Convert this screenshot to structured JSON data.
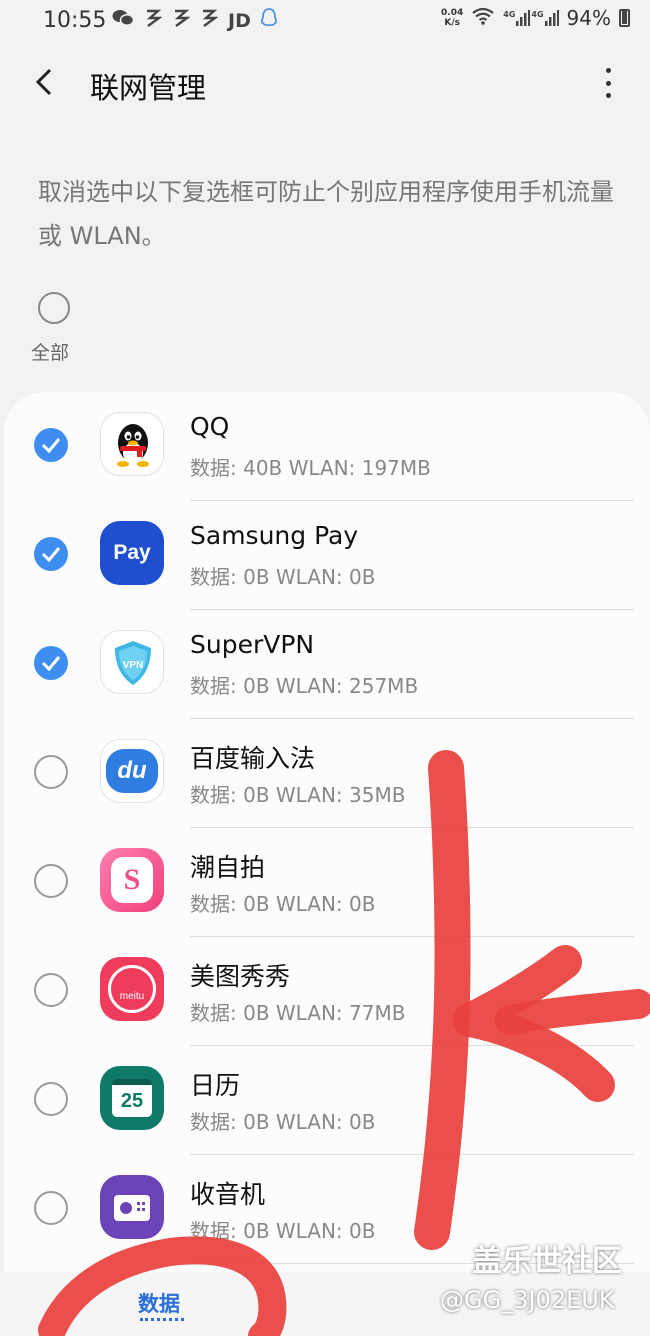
{
  "status_bar": {
    "time": "10:55",
    "left_icons": [
      "wechat-icon",
      "app-icon",
      "app-icon",
      "app-icon",
      "jd-icon",
      "qq-icon"
    ],
    "jd_label": "JD",
    "net_speed_value": "0.04",
    "net_speed_unit": "K/s",
    "signal_label_1": "4G",
    "signal_label_2": "4G",
    "battery": "94%"
  },
  "header": {
    "title": "联网管理",
    "back_icon": "back-arrow-icon",
    "more_icon": "more-vert-icon"
  },
  "description": "取消选中以下复选框可防止个别应用程序使用手机流量或 WLAN。",
  "all_toggle": {
    "label": "全部",
    "checked": false
  },
  "apps": [
    {
      "name": "QQ",
      "usage": "数据: 40B  WLAN: 197MB",
      "checked": true,
      "icon": "qq-penguin-icon"
    },
    {
      "name": "Samsung Pay",
      "usage": "数据: 0B  WLAN: 0B",
      "checked": true,
      "icon": "samsung-pay-icon",
      "icon_text": "Pay"
    },
    {
      "name": "SuperVPN",
      "usage": "数据: 0B  WLAN: 257MB",
      "checked": true,
      "icon": "supervpn-shield-icon",
      "icon_text": "VPN"
    },
    {
      "name": "百度输入法",
      "usage": "数据: 0B  WLAN: 35MB",
      "checked": false,
      "icon": "baidu-input-icon",
      "icon_text": "du"
    },
    {
      "name": "潮自拍",
      "usage": "数据: 0B  WLAN: 0B",
      "checked": false,
      "icon": "chaozipai-icon",
      "icon_text": "S"
    },
    {
      "name": "美图秀秀",
      "usage": "数据: 0B  WLAN: 77MB",
      "checked": false,
      "icon": "meitu-icon",
      "icon_text": "meitu"
    },
    {
      "name": "日历",
      "usage": "数据: 0B  WLAN: 0B",
      "checked": false,
      "icon": "calendar-icon",
      "icon_text": "25"
    },
    {
      "name": "收音机",
      "usage": "数据: 0B  WLAN: 0B",
      "checked": false,
      "icon": "radio-icon"
    }
  ],
  "bottom_tab": {
    "label": "数据"
  },
  "watermark": {
    "title": "盖乐世社区",
    "user": "@GG_3J02EUK"
  },
  "colors": {
    "accent": "#3e8ef1",
    "tab_active": "#2b6fd6",
    "scribble": "#e8403c"
  }
}
